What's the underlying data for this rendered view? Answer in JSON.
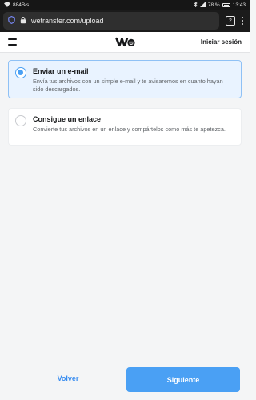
{
  "status_bar": {
    "network_speed": "884B/s",
    "battery": "78 %",
    "time": "13:43"
  },
  "browser": {
    "url": "wetransfer.com/upload",
    "tab_count": "2"
  },
  "header": {
    "logo": "we",
    "login_label": "Iniciar sesión"
  },
  "options": [
    {
      "title": "Enviar un e-mail",
      "description": "Envía tus archivos con un simple e-mail y te avisaremos en cuanto hayan sido descargados.",
      "selected": true
    },
    {
      "title": "Consigue un enlace",
      "description": "Convierte tus archivos en un enlace y compártelos como más te apetezca.",
      "selected": false
    }
  ],
  "footer": {
    "back_label": "Volver",
    "next_label": "Siguiente"
  },
  "colors": {
    "accent": "#4aa0f4",
    "selected_bg": "#e9f3ff"
  }
}
